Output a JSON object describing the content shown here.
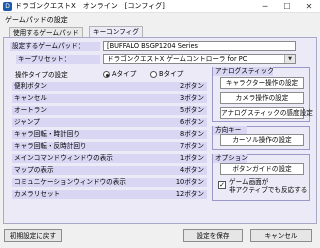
{
  "window": {
    "title": "ドラゴンクエストX　オンライン　[コンフィグ]",
    "min_glyph": "─",
    "max_glyph": "☐",
    "close_glyph": "✕"
  },
  "page": {
    "title": "ゲームパッドの設定"
  },
  "tabs": [
    {
      "label": "使用するゲームパッド",
      "active": false
    },
    {
      "label": "キーコンフィグ",
      "active": true
    }
  ],
  "pad": {
    "device_label": "設定するゲームパッド：",
    "device_value": "[BUFFALO BSGP1204 Series",
    "preset_label": "キープリセット：",
    "preset_value": "ドラゴンクエストX ゲームコントローラ for PC"
  },
  "operation_type": {
    "label": "操作タイプの設定",
    "option_a": "Aタイプ",
    "option_b": "Bタイプ",
    "selected": "A"
  },
  "bindings": [
    {
      "name": "便利ボタン",
      "value": "2ボタン"
    },
    {
      "name": "キャンセル",
      "value": "3ボタン"
    },
    {
      "name": "オートラン",
      "value": "5ボタン"
    },
    {
      "name": "ジャンプ",
      "value": "6ボタン"
    },
    {
      "name": "キャラ回転・時計回り",
      "value": "8ボタン"
    },
    {
      "name": "キャラ回転・反時計回り",
      "value": "7ボタン"
    },
    {
      "name": "メインコマンドウィンドウの表示",
      "value": "1ボタン"
    },
    {
      "name": "マップの表示",
      "value": "4ボタン"
    },
    {
      "name": "コミュニケーションウィンドウの表示",
      "value": "10ボタン"
    },
    {
      "name": "カメラリセット",
      "value": "12ボタン"
    }
  ],
  "analog_stick": {
    "title": "アナログスティック",
    "buttons": [
      "キャラクター操作の設定",
      "カメラ操作の設定",
      "アナログスティックの感度設定"
    ]
  },
  "dpad": {
    "title": "方向キー",
    "button": "カーソル操作の設定"
  },
  "options": {
    "title": "オプション",
    "button": "ボタンガイドの設定",
    "checkbox_line1": "ゲーム画面が",
    "checkbox_line2": "非アクティブでも反応する",
    "checkbox_checked": true,
    "check_glyph": "✓"
  },
  "footer": {
    "reset": "初期設定に戻す",
    "save": "設定を保存",
    "cancel": "キャンセル"
  }
}
